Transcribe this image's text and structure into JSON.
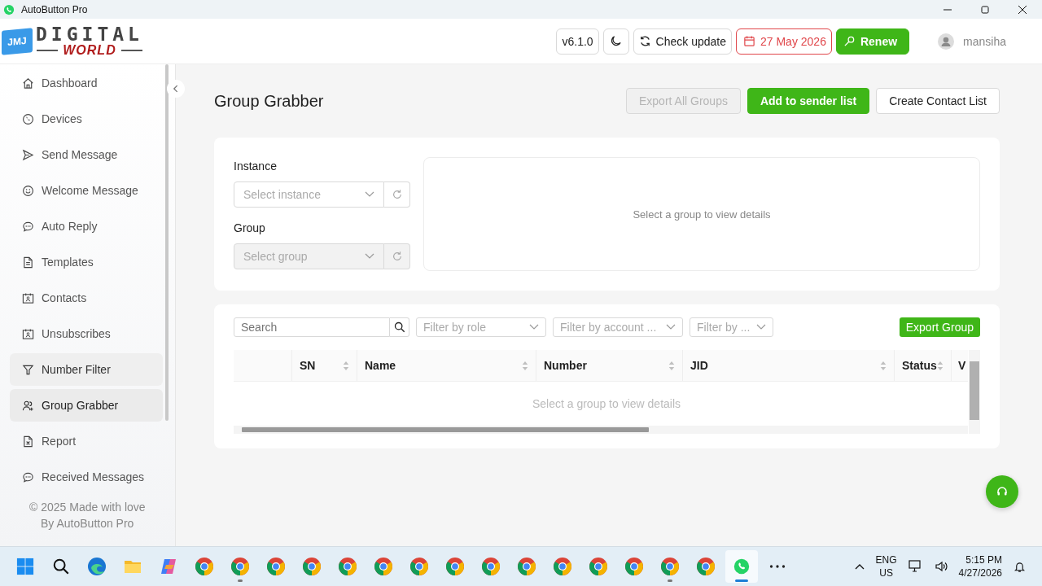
{
  "window": {
    "title": "AutoButton Pro"
  },
  "logo": {
    "badge": "JMJ",
    "line1": "DIGITAL",
    "line2": "WORLD"
  },
  "header": {
    "version": "v6.1.0",
    "check_update": "Check update",
    "expiry": "27 May 2026",
    "renew": "Renew",
    "user": "mansiha"
  },
  "sidebar": {
    "items": [
      {
        "label": "Dashboard",
        "selected": false,
        "hovered": false
      },
      {
        "label": "Devices",
        "selected": false,
        "hovered": false
      },
      {
        "label": "Send Message",
        "selected": false,
        "hovered": false
      },
      {
        "label": "Welcome Message",
        "selected": false,
        "hovered": false
      },
      {
        "label": "Auto Reply",
        "selected": false,
        "hovered": false
      },
      {
        "label": "Templates",
        "selected": false,
        "hovered": false
      },
      {
        "label": "Contacts",
        "selected": false,
        "hovered": false
      },
      {
        "label": "Unsubscribes",
        "selected": false,
        "hovered": false
      },
      {
        "label": "Number Filter",
        "selected": false,
        "hovered": true
      },
      {
        "label": "Group Grabber",
        "selected": true,
        "hovered": false
      },
      {
        "label": "Report",
        "selected": false,
        "hovered": false
      },
      {
        "label": "Received Messages",
        "selected": false,
        "hovered": false
      }
    ],
    "footer": [
      "© 2025 Made with love",
      "By AutoButton Pro"
    ]
  },
  "page": {
    "title": "Group Grabber",
    "actions": [
      {
        "label": "Export All Groups",
        "kind": "default",
        "disabled": true
      },
      {
        "label": "Add to sender list",
        "kind": "primary",
        "disabled": false
      },
      {
        "label": "Create Contact List",
        "kind": "default",
        "disabled": false
      }
    ]
  },
  "selectors": [
    {
      "label": "Instance",
      "placeholder": "Select instance",
      "disabled": false
    },
    {
      "label": "Group",
      "placeholder": "Select group",
      "disabled": true
    }
  ],
  "details": {
    "empty_text": "Select a group to view details"
  },
  "members": {
    "search": {
      "placeholder": "Search"
    },
    "filters": [
      "Filter by role",
      "Filter by account ...",
      "Filter by ..."
    ],
    "export": "Export Group",
    "table": {
      "columns": [
        "",
        "SN",
        "Name",
        "Number",
        "JID",
        "Status",
        "V"
      ],
      "empty_text": "Select a group to view details"
    }
  },
  "taskbar": {
    "apps": [
      {
        "kind": "start",
        "running": false,
        "selected": false
      },
      {
        "kind": "search",
        "running": false,
        "selected": false
      },
      {
        "kind": "edge",
        "running": false,
        "selected": false
      },
      {
        "kind": "files",
        "running": false,
        "selected": false
      },
      {
        "kind": "copilot",
        "running": false,
        "selected": false
      },
      {
        "kind": "chrome",
        "running": false,
        "selected": false
      },
      {
        "kind": "chrome",
        "running": true,
        "selected": false
      },
      {
        "kind": "chrome",
        "running": false,
        "selected": false
      },
      {
        "kind": "chrome",
        "running": false,
        "selected": false
      },
      {
        "kind": "chrome",
        "running": false,
        "selected": false
      },
      {
        "kind": "chrome",
        "running": false,
        "selected": false
      },
      {
        "kind": "chrome",
        "running": false,
        "selected": false
      },
      {
        "kind": "chrome",
        "running": false,
        "selected": false
      },
      {
        "kind": "chrome",
        "running": false,
        "selected": false
      },
      {
        "kind": "chrome",
        "running": false,
        "selected": false
      },
      {
        "kind": "chrome",
        "running": false,
        "selected": false
      },
      {
        "kind": "chrome",
        "running": false,
        "selected": false
      },
      {
        "kind": "chrome",
        "running": false,
        "selected": false
      },
      {
        "kind": "chrome",
        "running": true,
        "selected": false
      },
      {
        "kind": "chrome",
        "running": false,
        "selected": false
      },
      {
        "kind": "whatsapp",
        "running": true,
        "selected": true
      },
      {
        "kind": "more",
        "running": false,
        "selected": false
      }
    ],
    "language": [
      "ENG",
      "US"
    ],
    "time": "5:15 PM",
    "date": "4/27/2026"
  }
}
